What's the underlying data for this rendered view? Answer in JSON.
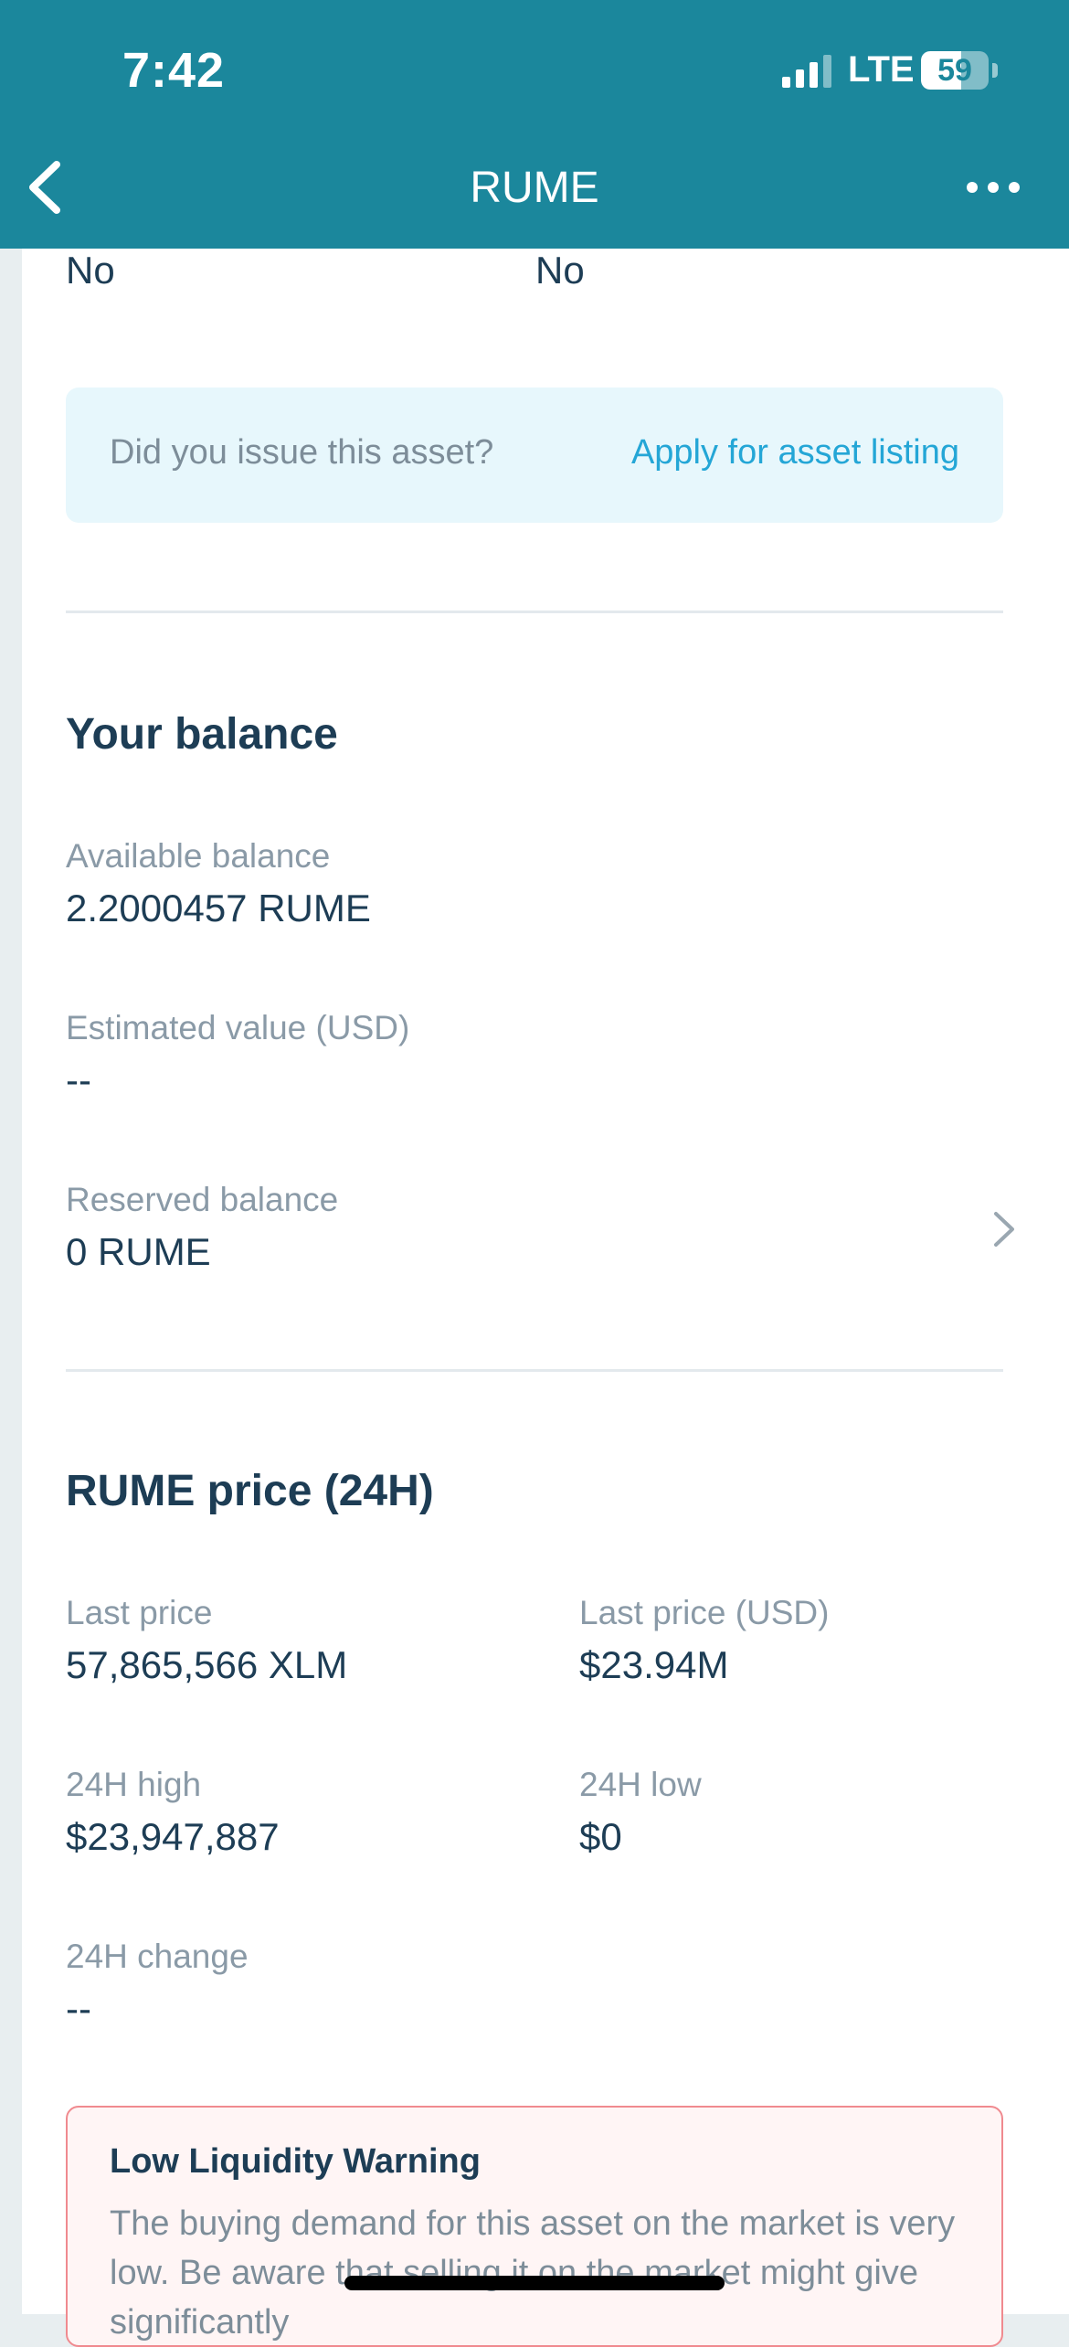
{
  "status_bar": {
    "time": "7:42",
    "network": "LTE",
    "battery_level": "59",
    "battery_fraction": 0.59
  },
  "nav": {
    "title": "RUME",
    "back_icon": "chevron-left-icon",
    "more_icon": "ellipsis-icon"
  },
  "top_row": {
    "left_value": "No",
    "right_value": "No"
  },
  "issue_banner": {
    "question": "Did you issue this asset?",
    "link": "Apply for asset listing"
  },
  "balance": {
    "title": "Your balance",
    "available_label": "Available balance",
    "available_value": "2.2000457 RUME",
    "estimated_label": "Estimated value (USD)",
    "estimated_value": "--",
    "reserved_label": "Reserved balance",
    "reserved_value": "0 RUME"
  },
  "price": {
    "title": "RUME price (24H)",
    "last_price_label": "Last price",
    "last_price_value": "57,865,566 XLM",
    "last_price_usd_label": "Last price (USD)",
    "last_price_usd_value": "$23.94M",
    "high_label": "24H high",
    "high_value": "$23,947,887",
    "low_label": "24H low",
    "low_value": "$0",
    "change_label": "24H change",
    "change_value": "--"
  },
  "warning": {
    "title": "Low Liquidity Warning",
    "text": "The buying demand for this asset on the market is very low. Be aware that selling it on the market might give significantly"
  },
  "colors": {
    "header": "#1b879c",
    "link": "#24a6d6",
    "warning_border": "#f08a8f"
  }
}
